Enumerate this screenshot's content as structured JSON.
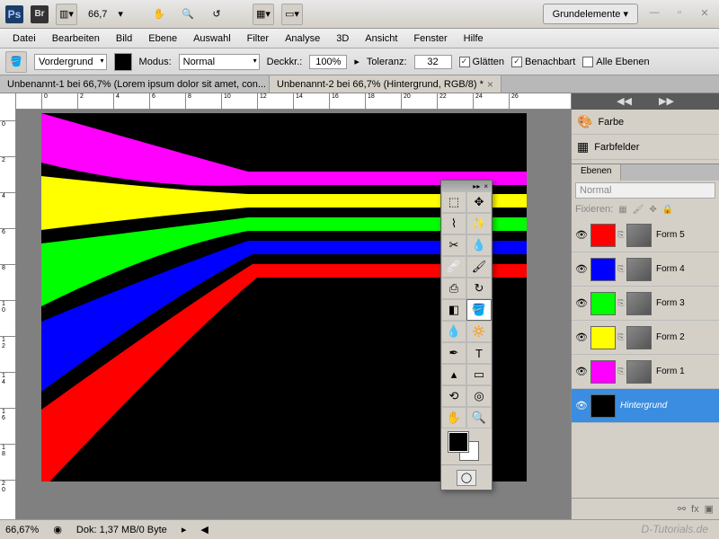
{
  "topbar": {
    "zoom": "66,7",
    "workspace": "Grundelemente ▾"
  },
  "menu": [
    "Datei",
    "Bearbeiten",
    "Bild",
    "Ebene",
    "Auswahl",
    "Filter",
    "Analyse",
    "3D",
    "Ansicht",
    "Fenster",
    "Hilfe"
  ],
  "options": {
    "fill_label": "Vordergrund",
    "mode_label": "Modus:",
    "mode_value": "Normal",
    "opacity_label": "Deckkr.:",
    "opacity_value": "100%",
    "tolerance_label": "Toleranz:",
    "tolerance_value": "32",
    "antialias": "Glätten",
    "contiguous": "Benachbart",
    "all_layers": "Alle Ebenen"
  },
  "tabs": [
    {
      "title": "Unbenannt-1 bei 66,7% (Lorem ipsum dolor sit amet, con... *"
    },
    {
      "title": "Unbenannt-2 bei 66,7% (Hintergrund, RGB/8) *"
    }
  ],
  "status": {
    "zoom": "66,67%",
    "doc": "Dok: 1,37 MB/0 Byte"
  },
  "side_panels": {
    "color": "Farbe",
    "swatches": "Farbfelder"
  },
  "layers_panel": {
    "title": "Ebenen",
    "blend": "Normal",
    "lock_label": "Fixieren:",
    "items": [
      {
        "name": "Form 5",
        "color": "#ff0000"
      },
      {
        "name": "Form 4",
        "color": "#0000ff"
      },
      {
        "name": "Form 3",
        "color": "#00ff00"
      },
      {
        "name": "Form 2",
        "color": "#ffff00"
      },
      {
        "name": "Form 1",
        "color": "#ff00ff"
      },
      {
        "name": "Hintergrund",
        "color": "#000000"
      }
    ]
  },
  "stripes": [
    {
      "color": "#ff00ff"
    },
    {
      "color": "#ffff00"
    },
    {
      "color": "#00ff00"
    },
    {
      "color": "#0000ff"
    },
    {
      "color": "#ff0000"
    }
  ],
  "watermark": "D-Tutorials.de"
}
